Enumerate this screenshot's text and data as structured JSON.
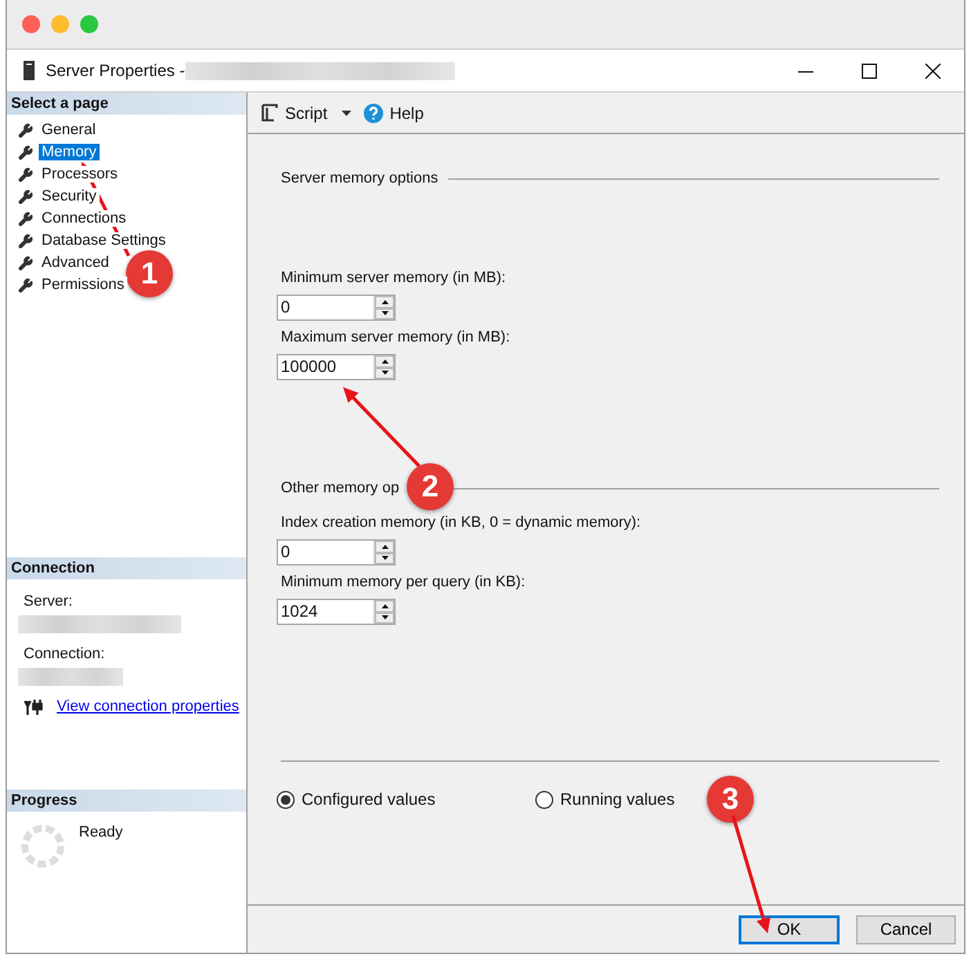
{
  "window": {
    "title": "Server Properties -"
  },
  "sidebar": {
    "header": "Select a page",
    "items": [
      {
        "label": "General",
        "selected": false
      },
      {
        "label": "Memory",
        "selected": true
      },
      {
        "label": "Processors",
        "selected": false
      },
      {
        "label": "Security",
        "selected": false
      },
      {
        "label": "Connections",
        "selected": false
      },
      {
        "label": "Database Settings",
        "selected": false
      },
      {
        "label": "Advanced",
        "selected": false
      },
      {
        "label": "Permissions",
        "selected": false
      }
    ]
  },
  "connection": {
    "header": "Connection",
    "server_label": "Server:",
    "connection_label": "Connection:",
    "link": "View connection properties"
  },
  "progress": {
    "header": "Progress",
    "status": "Ready"
  },
  "toolbar": {
    "script": "Script",
    "help": "Help"
  },
  "groups": [
    {
      "title": "Server memory options",
      "fields": [
        {
          "label": "Minimum server memory (in MB):",
          "value": "0"
        },
        {
          "label": "Maximum server memory (in MB):",
          "value": "100000"
        }
      ]
    },
    {
      "title": "Other memory op",
      "fields": [
        {
          "label": "Index creation memory (in KB, 0 = dynamic memory):",
          "value": "0"
        },
        {
          "label": "Minimum memory per query (in KB):",
          "value": "1024"
        }
      ]
    }
  ],
  "radios": [
    {
      "label": "Configured values",
      "selected": true
    },
    {
      "label": "Running values",
      "selected": false
    }
  ],
  "buttons": [
    {
      "label": "OK",
      "default": true
    },
    {
      "label": "Cancel",
      "default": false
    }
  ],
  "annotations": [
    {
      "number": "1"
    },
    {
      "number": "2"
    },
    {
      "number": "3"
    }
  ]
}
